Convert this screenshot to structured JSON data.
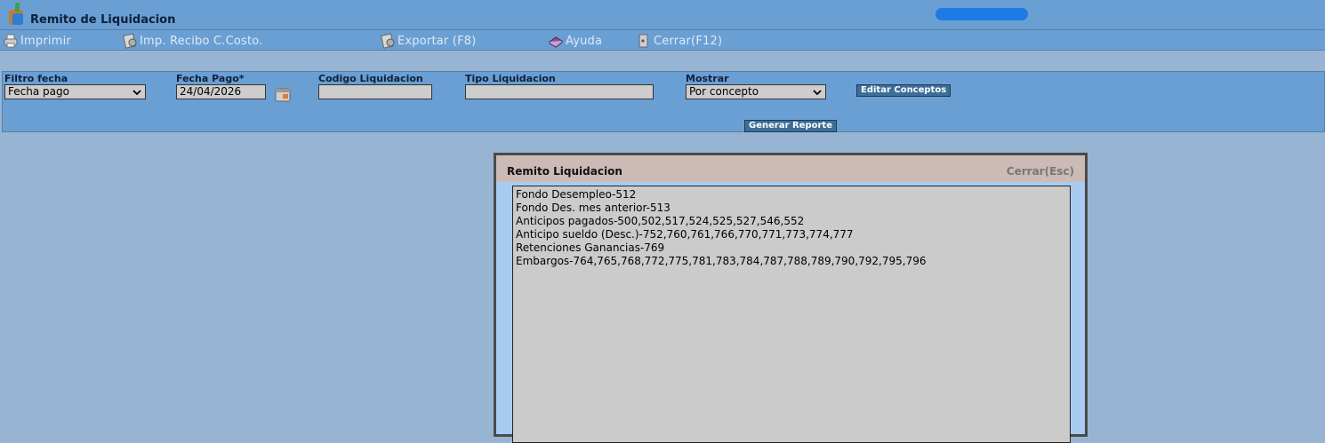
{
  "window": {
    "title": "Remito de Liquidacion",
    "logo_icon": "app-logo-icon"
  },
  "toolbar": {
    "imprimir": "Imprimir",
    "imp_recibo": "Imp. Recibo C.Costo.",
    "exportar": "Exportar (F8)",
    "ayuda": "Ayuda",
    "cerrar": "Cerrar(F12)"
  },
  "filters": {
    "filtro_fecha": {
      "label": "Filtro fecha",
      "value": "Fecha pago"
    },
    "fecha_pago": {
      "label": "Fecha Pago*",
      "value": "24/04/2026"
    },
    "codigo_liquidacion": {
      "label": "Codigo Liquidacion",
      "value": ""
    },
    "tipo_liquidacion": {
      "label": "Tipo Liquidacion",
      "value": ""
    },
    "mostrar": {
      "label": "Mostrar",
      "value": "Por concepto"
    },
    "editar_conceptos": "Editar Conceptos",
    "generar_reporte": "Generar Reporte"
  },
  "modal": {
    "title": "Remito Liquidacion",
    "close": "Cerrar(Esc)",
    "lines": [
      "Fondo Desempleo-512",
      "Fondo Des. mes anterior-513",
      "Anticipos pagados-500,502,517,524,525,527,546,552",
      "Anticipo sueldo (Desc.)-752,760,761,766,770,771,773,774,777",
      "Retenciones Ganancias-769",
      "Embargos-764,765,768,772,775,781,783,784,787,788,789,790,792,795,796"
    ]
  },
  "colors": {
    "header": "#6a9fd3",
    "background": "#97b5d3",
    "modal_header": "#cbbab6"
  }
}
